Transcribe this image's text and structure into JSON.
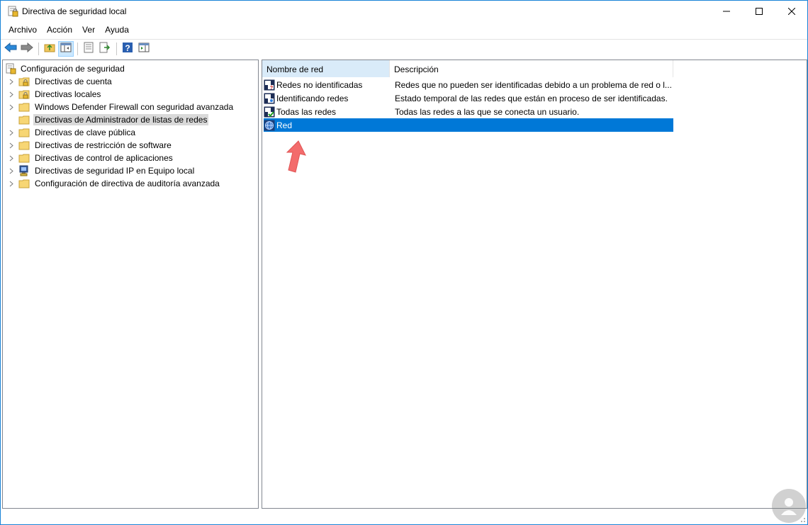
{
  "window": {
    "title": "Directiva de seguridad local",
    "accent": "#1883d7"
  },
  "titlebar_buttons": [
    "minimize-icon",
    "maximize-icon",
    "close-icon"
  ],
  "menu": [
    "Archivo",
    "Acción",
    "Ver",
    "Ayuda"
  ],
  "toolbar": [
    "back-arrow-icon",
    "forward-arrow-icon",
    "up-folder-icon",
    "show-hide-tree-icon",
    "properties-icon",
    "export-list-icon",
    "help-icon",
    "show-hide-action-pane-icon"
  ],
  "tree": {
    "root": "Configuración de seguridad",
    "items": [
      {
        "label": "Directivas de cuenta",
        "icon": "locked-folder-icon"
      },
      {
        "label": "Directivas locales",
        "icon": "locked-folder-icon"
      },
      {
        "label": "Windows Defender Firewall con seguridad avanzada",
        "icon": "folder-icon"
      },
      {
        "label": "Directivas de Administrador de listas de redes",
        "icon": "folder-icon",
        "selected": true
      },
      {
        "label": "Directivas de clave pública",
        "icon": "folder-icon"
      },
      {
        "label": "Directivas de restricción de software",
        "icon": "folder-icon"
      },
      {
        "label": "Directivas de control de aplicaciones",
        "icon": "folder-icon"
      },
      {
        "label": "Directivas de seguridad IP en Equipo local",
        "icon": "ip-security-icon"
      },
      {
        "label": "Configuración de directiva de auditoría avanzada",
        "icon": "folder-icon"
      }
    ]
  },
  "list": {
    "columns": [
      "Nombre de red",
      "Descripción"
    ],
    "rows": [
      {
        "name": "Redes no identificadas",
        "description": "Redes que no pueden ser identificadas debido a un problema de red o l...",
        "icon": "network-unidentified-icon"
      },
      {
        "name": "Identificando redes",
        "description": "Estado temporal de las redes que están en proceso de ser identificadas.",
        "icon": "network-identifying-icon"
      },
      {
        "name": "Todas las redes",
        "description": "Todas las redes a las que se conecta un usuario.",
        "icon": "network-all-icon"
      },
      {
        "name": "Red",
        "description": "",
        "icon": "network-globe-icon",
        "selected": true
      }
    ]
  },
  "colors": {
    "selection": "#0078d7",
    "tree_selection": "#d9d9d9",
    "sorted_header": "#d9ebf9",
    "annotation_arrow": "#f36c6c"
  }
}
